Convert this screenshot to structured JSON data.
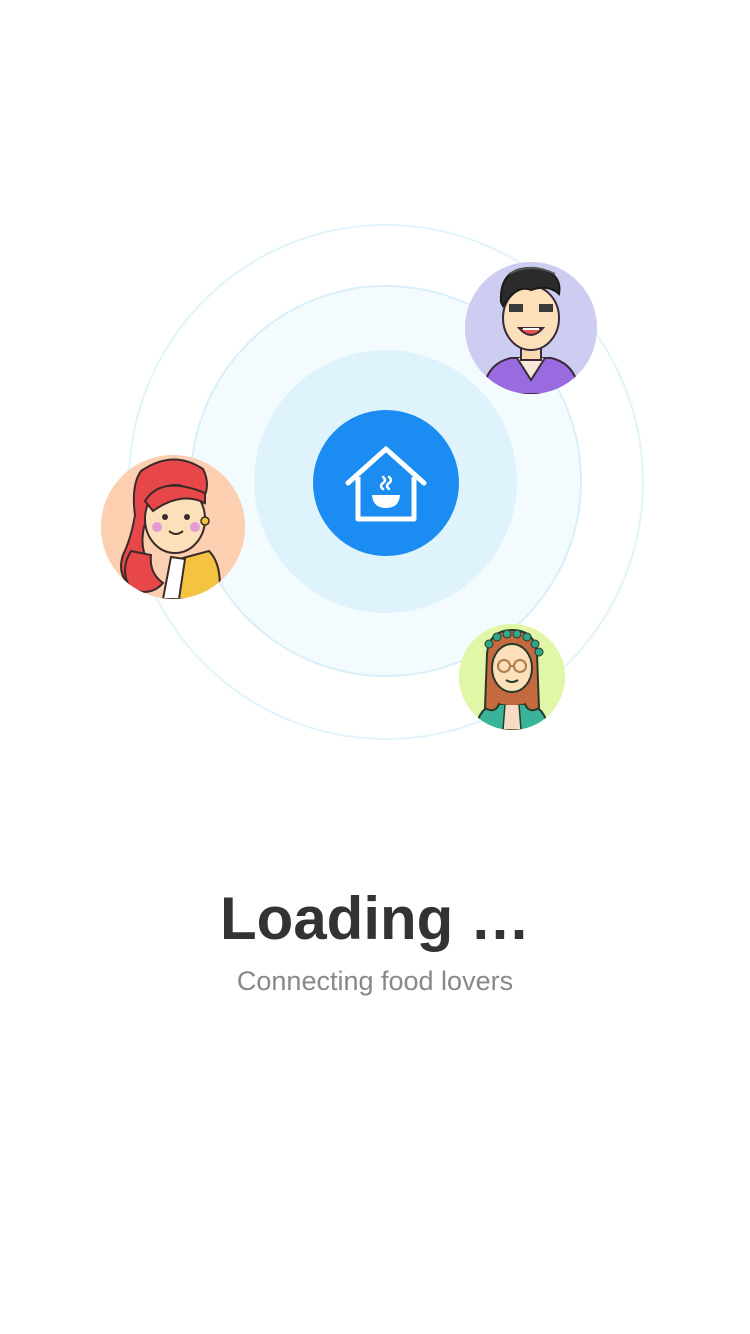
{
  "loading": {
    "title": "Loading …",
    "subtitle": "Connecting food lovers"
  },
  "icons": {
    "center": "house-with-bowl-icon"
  },
  "avatars": [
    {
      "name": "man-avatar"
    },
    {
      "name": "red-hair-woman-avatar"
    },
    {
      "name": "flower-crown-woman-avatar"
    }
  ],
  "colors": {
    "accent": "#1a8cf2",
    "ring_inner": "#dff3fc",
    "ring_middle": "#f4fbfe",
    "ring_border": "#e1f3fb",
    "title": "#333333",
    "subtitle": "#888888"
  }
}
